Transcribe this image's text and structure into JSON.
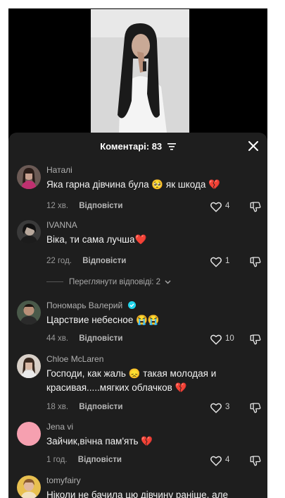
{
  "header": {
    "title": "Коментарі: 83"
  },
  "comments": [
    {
      "username": "Наталі",
      "text": "Яка гарна дівчина була 🥺 як шкода 💔",
      "time": "12 хв.",
      "reply": "Відповісти",
      "likes": "4"
    },
    {
      "username": "IVANNA",
      "text": "Віка, ти сама лучша❤️",
      "time": "22 год.",
      "reply": "Відповісти",
      "likes": "1"
    },
    {
      "username": "Пономарь Валерий",
      "text": "Царствие небесное 😭😭",
      "time": "44 хв.",
      "reply": "Відповісти",
      "likes": "10"
    },
    {
      "username": "Chloe McLaren",
      "text": "Господи, как жаль 😞 такая молодая и красивая.....мягких облачков 💔",
      "time": "18 хв.",
      "reply": "Відповісти",
      "likes": "3"
    },
    {
      "username": "Jena vi",
      "text": "Зайчик,вічна пам'ять 💔",
      "time": "1 год.",
      "reply": "Відповісти",
      "likes": "4"
    },
    {
      "username": "tomyfairy",
      "text": "Ніколи не бачила цю дівчину раніше, але"
    }
  ],
  "view_replies": "Переглянути відповіді: 2",
  "colors": {
    "sheet": "#1e1e1e",
    "heart_red": "#e8283c",
    "verified": "#20d5ec",
    "jena_avatar": "#f6a0b0"
  }
}
